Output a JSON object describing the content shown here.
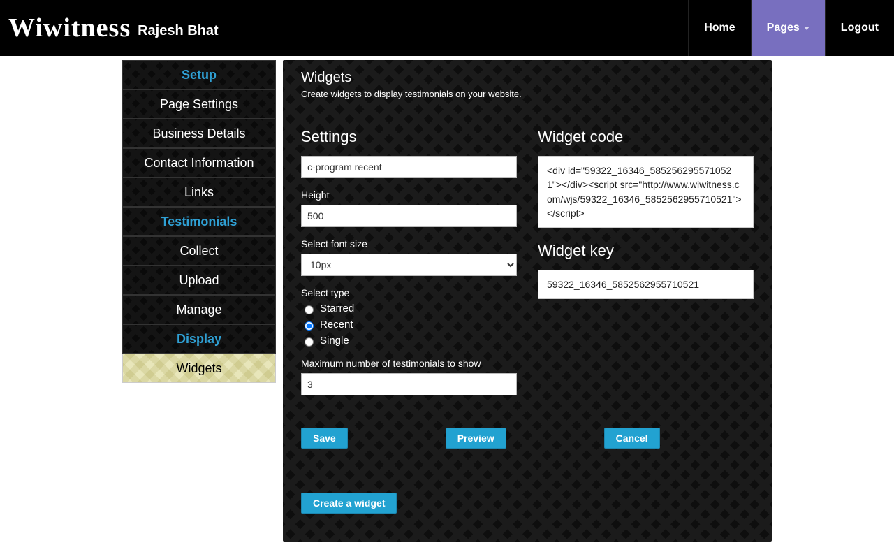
{
  "header": {
    "logo": "Wiwitness",
    "username": "Rajesh Bhat",
    "nav": {
      "home": "Home",
      "pages": "Pages",
      "logout": "Logout"
    }
  },
  "sidebar": {
    "setup": {
      "header": "Setup",
      "items": [
        "Page Settings",
        "Business Details",
        "Contact Information",
        "Links"
      ]
    },
    "testimonials": {
      "header": "Testimonials",
      "items": [
        "Collect",
        "Upload",
        "Manage"
      ]
    },
    "display": {
      "header": "Display",
      "items": [
        "Widgets"
      ]
    }
  },
  "page": {
    "title": "Widgets",
    "subtitle": "Create widgets to display testimonials on your website."
  },
  "settings": {
    "heading": "Settings",
    "name_value": "c-program recent",
    "height_label": "Height",
    "height_value": "500",
    "font_label": "Select font size",
    "font_value": "10px",
    "type_label": "Select type",
    "type_options": {
      "starred": "Starred",
      "recent": "Recent",
      "single": "Single"
    },
    "type_selected": "recent",
    "max_label": "Maximum number of testimonials to show",
    "max_value": "3"
  },
  "widget": {
    "code_heading": "Widget code",
    "code_value": "<div id=\"59322_16346_5852562955710521\"></div><script src=\"http://www.wiwitness.com/wjs/59322_16346_5852562955710521\"></script>",
    "key_heading": "Widget key",
    "key_value": "59322_16346_5852562955710521"
  },
  "buttons": {
    "save": "Save",
    "preview": "Preview",
    "cancel": "Cancel",
    "create": "Create a widget"
  }
}
